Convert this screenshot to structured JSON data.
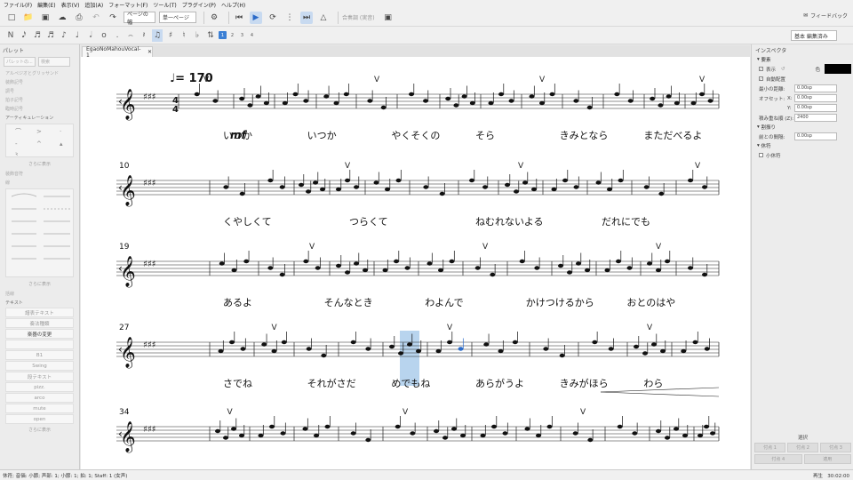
{
  "menu": [
    "ファイル(F)",
    "編集(E)",
    "表示(V)",
    "追加(A)",
    "フォーマット(F)",
    "ツール(T)",
    "プラグイン(P)",
    "ヘルプ(H)"
  ],
  "toolbar": {
    "view_mode": "ページの幅",
    "page_view": "単一ページ",
    "concert_pitch": "合奏調 (実音)",
    "feedback": "フィードバック",
    "workspace": "基本 編集済み",
    "voices": [
      "1",
      "2",
      "3",
      "4"
    ]
  },
  "palette": {
    "title": "パレット",
    "search_btn": "パレットの...",
    "search_placeholder": "検索",
    "sections": [
      "アルペジオとグリッサンド",
      "装飾記号",
      "調号",
      "拍子記号",
      "臨時記号",
      "アーティキュレーション",
      "装飾音符",
      "線",
      "括線"
    ],
    "more": "さらに表示",
    "text_section": "テキスト",
    "text_items": [
      "譜表テキスト",
      "奏法種類",
      "楽器の変更",
      "",
      "B1",
      "Swing",
      "段テキスト",
      "pizz.",
      "arco",
      "mute",
      "open"
    ]
  },
  "document": {
    "tab": "EgaoNoMahouVocal-1",
    "tempo": "= 170",
    "dynamic": "mf",
    "lyrics": [
      [
        "いつか",
        "いつか",
        "やくそくの",
        "そら",
        "きみとなら",
        "まただべるよ"
      ],
      [
        "くやしくて",
        "つらくて",
        "ねむれないよる",
        "だれにでも"
      ],
      [
        "あるよ",
        "そんなとき",
        "わよんで",
        "かけつけるから",
        "おとのはや"
      ],
      [
        "さでね",
        "それがさだ",
        "めでもね",
        "あらがうよ",
        "きみがほら",
        "わら"
      ]
    ],
    "measure_numbers": [
      "10",
      "19",
      "27",
      "34"
    ]
  },
  "inspector": {
    "title": "インスペクタ",
    "section_element": "要素",
    "show": "表示",
    "color_label": "色",
    "auto_place": "自動配置",
    "min_distance_label": "最小の距離:",
    "min_distance": "0.00sp",
    "offset_label": "オフセット:",
    "offset_x_label": "X:",
    "offset_x": "0.00sp",
    "offset_y_label": "Y:",
    "offset_y": "0.00sp",
    "stacking_label": "積み重ね順 (Z):",
    "stacking": "2400",
    "section_segment": "割振り",
    "leading_space_label": "前との間隔:",
    "leading_space": "0.00sp",
    "section_rest": "休符",
    "small_rest": "小休符",
    "selection_label": "選択",
    "selection_buttons": [
      "付点 1",
      "付点 2",
      "付点 3",
      "付点 4",
      "適用"
    ]
  },
  "status": {
    "left": "休符; 音価: 小節; 声部: 1; 小節: 1; 拍: 1; Staff: 1 (女声)",
    "right": "再生",
    "time": "30:02:00"
  }
}
